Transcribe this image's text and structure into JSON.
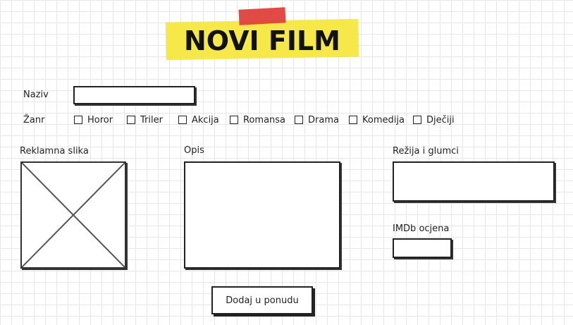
{
  "header": {
    "title": "NOVI FILM"
  },
  "form": {
    "naziv_label": "Naziv",
    "naziv_value": "",
    "zanr_label": "Žanr",
    "genres": [
      "Horor",
      "Triler",
      "Akcija",
      "Romansa",
      "Drama",
      "Komedija",
      "Dječiji"
    ],
    "reklamna_label": "Reklamna slika",
    "opis_label": "Opis",
    "opis_value": "",
    "rezija_label": "Režija i glumci",
    "rezija_value": "",
    "imdb_label": "IMDb ocjena",
    "imdb_value": "",
    "submit_label": "Dodaj u ponudu"
  },
  "colors": {
    "banner": "#f7e84a",
    "tape": "#e0413b"
  }
}
